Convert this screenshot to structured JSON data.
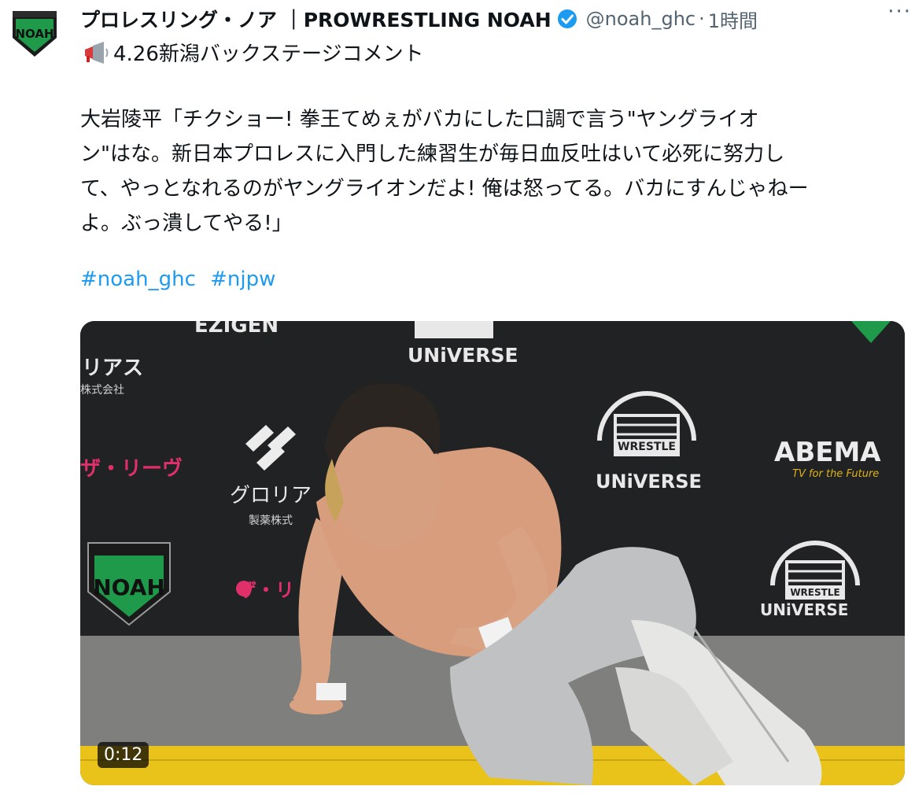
{
  "tweet": {
    "display_name": "プロレスリング・ノア ｜PROWRESTLING NOAH",
    "handle": "@noah_ghc",
    "separator": "·",
    "time": "1時間",
    "more": "···",
    "verified_icon": "verified-badge-icon",
    "subtitle": "4.26新潟バックステージコメント",
    "subtitle_icon": "megaphone-icon",
    "body_lines": [
      "大岩陵平「チクショー! 拳王てめぇがバカにした口調で言う\"ヤングライオ",
      "ン\"はな。新日本プロレスに入門した練習生が毎日血反吐はいて必死に努力し",
      "て、やっとなれるのがヤングライオンだよ! 俺は怒ってる。バカにすんじゃねー",
      "よ。ぶっ潰してやる!」"
    ],
    "hashtags": [
      "#noah_ghc",
      "#njpw"
    ]
  },
  "media": {
    "type": "video",
    "duration": "0:12",
    "backdrop_texts": {
      "ezigen": "EZIGEN",
      "riasu": "リアス",
      "kabushiki": "株式会社",
      "zarive": "ザ・リーヴ",
      "zarive2": "ザ・リ",
      "glorias": "グロリア",
      "seiyaku": "製薬株式",
      "wrestle": "WRESTLE",
      "universe": "UNiVERSE",
      "abema": "ABEMA",
      "abema_tag": "TV for the Future",
      "noah": "NOAH"
    }
  },
  "colors": {
    "link": "#1d9bf0",
    "secondary_text": "#536471",
    "verified": "#1d9bf0",
    "noah_green": "#1e9a4a"
  }
}
